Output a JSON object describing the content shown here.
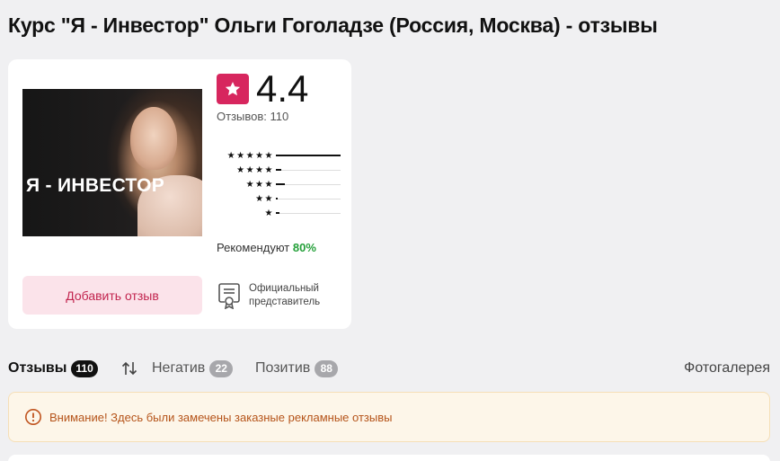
{
  "page": {
    "title": "Курс \"Я - Инвестор\" Ольги Гоголадзе (Россия, Москва) - отзывы"
  },
  "product": {
    "cover_text": "Я - ИНВЕСТОР",
    "rating": "4.4",
    "reviews_label": "Отзывов: 110",
    "distribution": [
      {
        "stars": "★★★★★",
        "share": 1.0
      },
      {
        "stars": "★★★★",
        "share": 0.08
      },
      {
        "stars": "★★★",
        "share": 0.14
      },
      {
        "stars": "★★",
        "share": 0.01
      },
      {
        "stars": "★",
        "share": 0.05
      }
    ],
    "recommend_label": "Рекомендуют",
    "recommend_value": "80%",
    "add_review": "Добавить отзыв",
    "official_line1": "Официальный",
    "official_line2": "представитель"
  },
  "tabs": [
    {
      "label": "Отзывы",
      "count": "110",
      "active": true
    },
    {
      "label": "Негатив",
      "count": "22",
      "active": false
    },
    {
      "label": "Позитив",
      "count": "88",
      "active": false
    }
  ],
  "gallery_label": "Фотогалерея",
  "warning": {
    "text": "Внимание! Здесь были замечены заказные рекламные отзывы"
  },
  "colors": {
    "brand": "#d7265e",
    "recommend": "#25a03a",
    "warning_text": "#b5541a"
  }
}
